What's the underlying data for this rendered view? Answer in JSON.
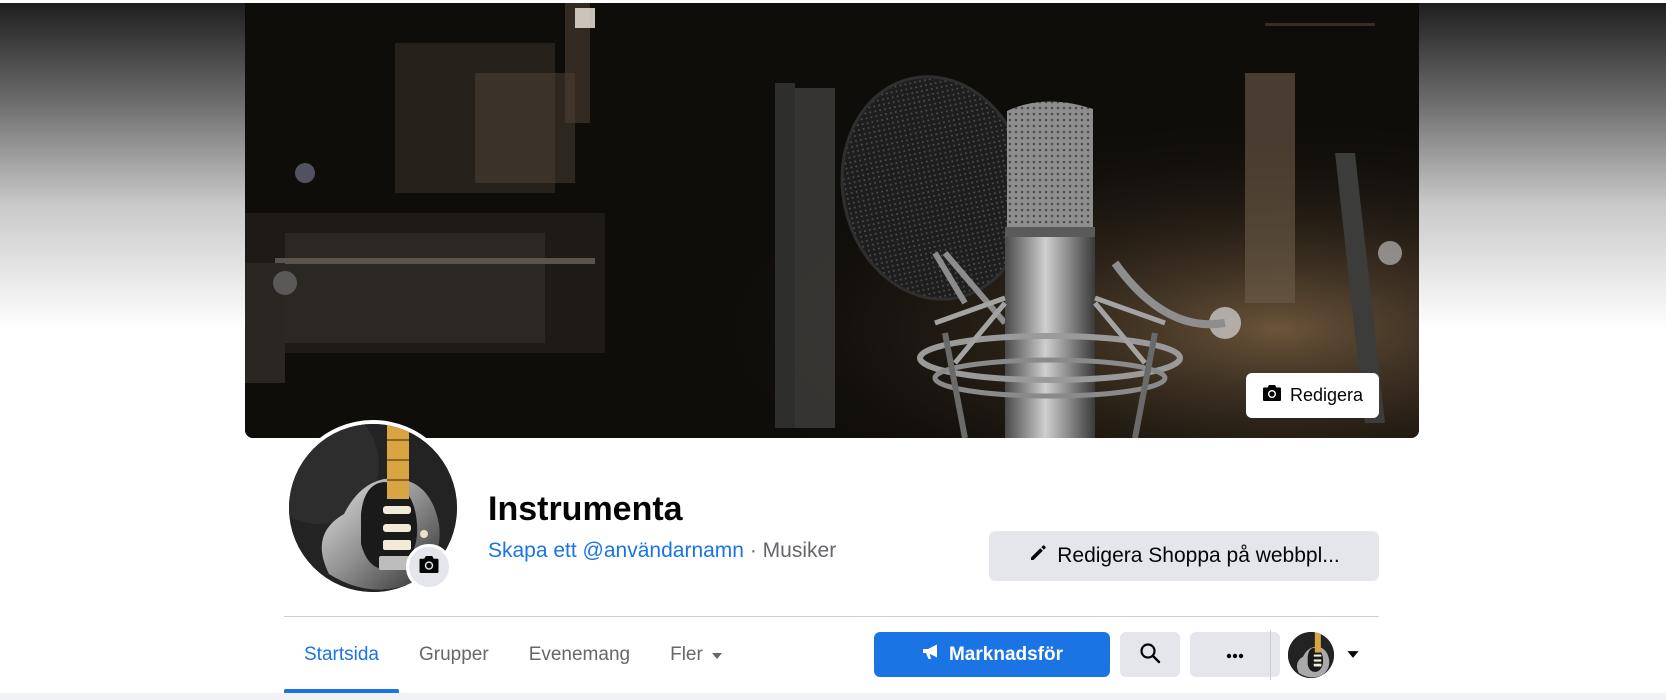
{
  "cover": {
    "edit_label": "Redigera"
  },
  "page": {
    "name": "Instrumenta",
    "username_link": "Skapa ett @användarnamn",
    "separator": "·",
    "category": "Musiker"
  },
  "actions": {
    "edit_shop_label": "Redigera Shoppa på webbpl...",
    "promote_label": "Marknadsför"
  },
  "tabs": [
    {
      "label": "Startsida",
      "active": true
    },
    {
      "label": "Grupper",
      "active": false
    },
    {
      "label": "Evenemang",
      "active": false
    },
    {
      "label": "Fler",
      "active": false
    }
  ],
  "icons": {
    "cover_edit": "camera-icon",
    "avatar_edit": "camera-icon",
    "edit_shop": "pencil-icon",
    "promote": "megaphone-icon",
    "search": "search-icon",
    "more": "ellipsis-icon",
    "tab_more": "caret-down-icon",
    "profile_switch": "caret-down-icon"
  },
  "colors": {
    "accent": "#1b74e4",
    "button_gray": "#e4e6eb",
    "secondary_text": "#65676b"
  }
}
